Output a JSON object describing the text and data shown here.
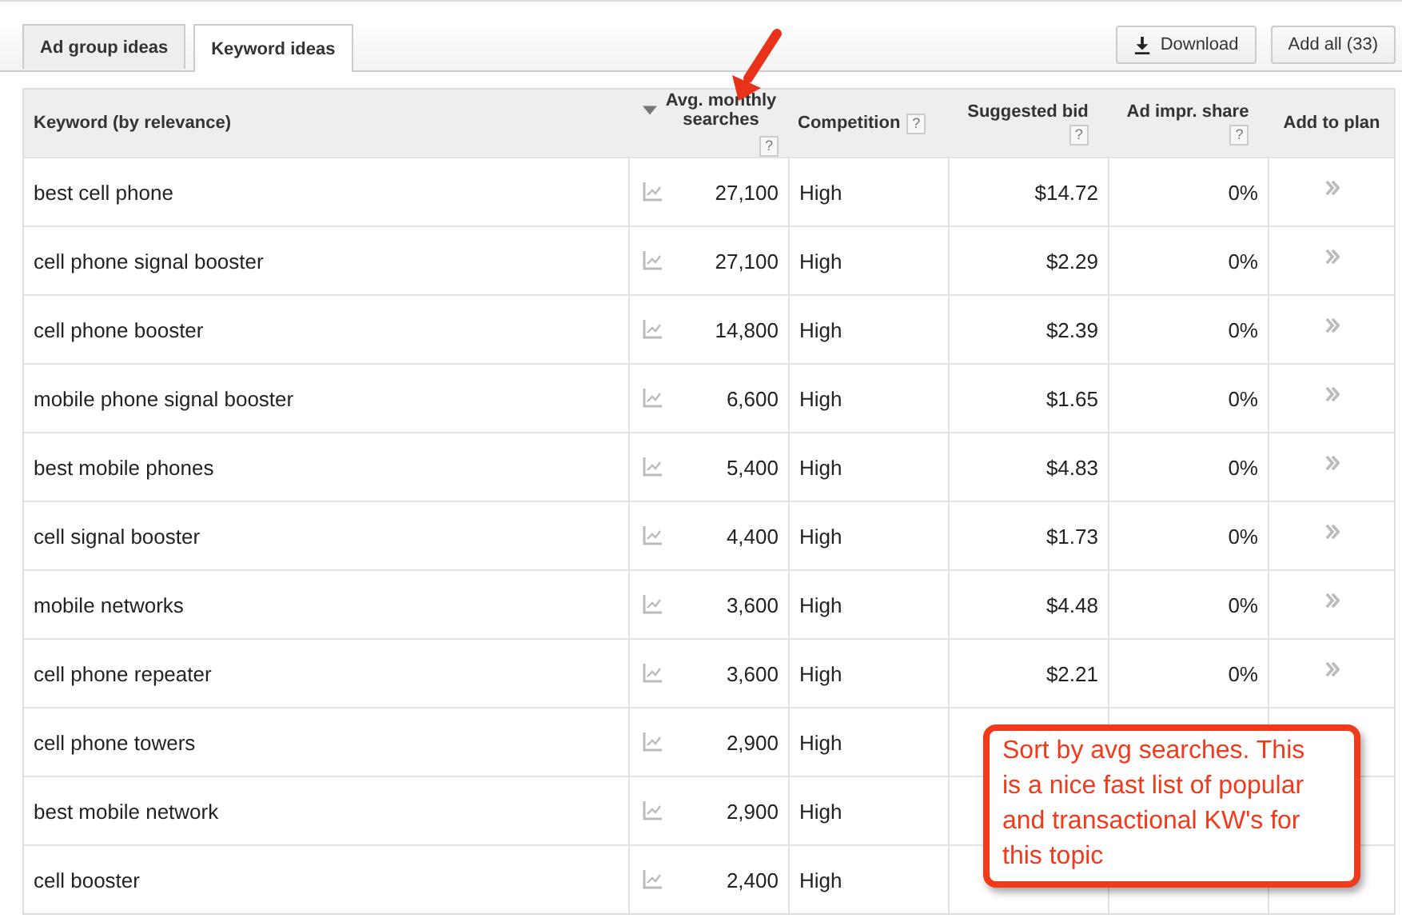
{
  "tabs": [
    {
      "label": "Ad group ideas",
      "selected": false
    },
    {
      "label": "Keyword ideas",
      "selected": true
    }
  ],
  "buttons": [
    {
      "label": "Download",
      "kind": "download"
    },
    {
      "label": "Add all (33)",
      "kind": "plain"
    }
  ],
  "table": {
    "columns": [
      {
        "label": "Keyword (by relevance)",
        "sorted": false
      },
      {
        "label": "Avg. monthly searches",
        "help": "?",
        "sorted": true
      },
      {
        "label": "Competition",
        "help": "?",
        "sorted": false
      },
      {
        "label": "Suggested bid",
        "help": "?",
        "sorted": false
      },
      {
        "label": "Ad impr. share",
        "help": "?",
        "sorted": false
      },
      {
        "label": "Add to plan",
        "sorted": false
      }
    ],
    "rows": [
      {
        "keyword": "best cell phone",
        "searches": "27,100",
        "competition": "High",
        "bid": "$14.72",
        "share": "0%"
      },
      {
        "keyword": "cell phone signal booster",
        "searches": "27,100",
        "competition": "High",
        "bid": "$2.29",
        "share": "0%"
      },
      {
        "keyword": "cell phone booster",
        "searches": "14,800",
        "competition": "High",
        "bid": "$2.39",
        "share": "0%"
      },
      {
        "keyword": "mobile phone signal booster",
        "searches": "6,600",
        "competition": "High",
        "bid": "$1.65",
        "share": "0%"
      },
      {
        "keyword": "best mobile phones",
        "searches": "5,400",
        "competition": "High",
        "bid": "$4.83",
        "share": "0%"
      },
      {
        "keyword": "cell signal booster",
        "searches": "4,400",
        "competition": "High",
        "bid": "$1.73",
        "share": "0%"
      },
      {
        "keyword": "mobile networks",
        "searches": "3,600",
        "competition": "High",
        "bid": "$4.48",
        "share": "0%"
      },
      {
        "keyword": "cell phone repeater",
        "searches": "3,600",
        "competition": "High",
        "bid": "$2.21",
        "share": "0%"
      },
      {
        "keyword": "cell phone towers",
        "searches": "2,900",
        "competition": "High"
      },
      {
        "keyword": "best mobile network",
        "searches": "2,900",
        "competition": "High"
      },
      {
        "keyword": "cell booster",
        "searches": "2,400",
        "competition": "High"
      }
    ]
  },
  "callout": {
    "text": "Sort by avg searches. This is a nice fast list of popular and transactional KW's for this topic"
  }
}
